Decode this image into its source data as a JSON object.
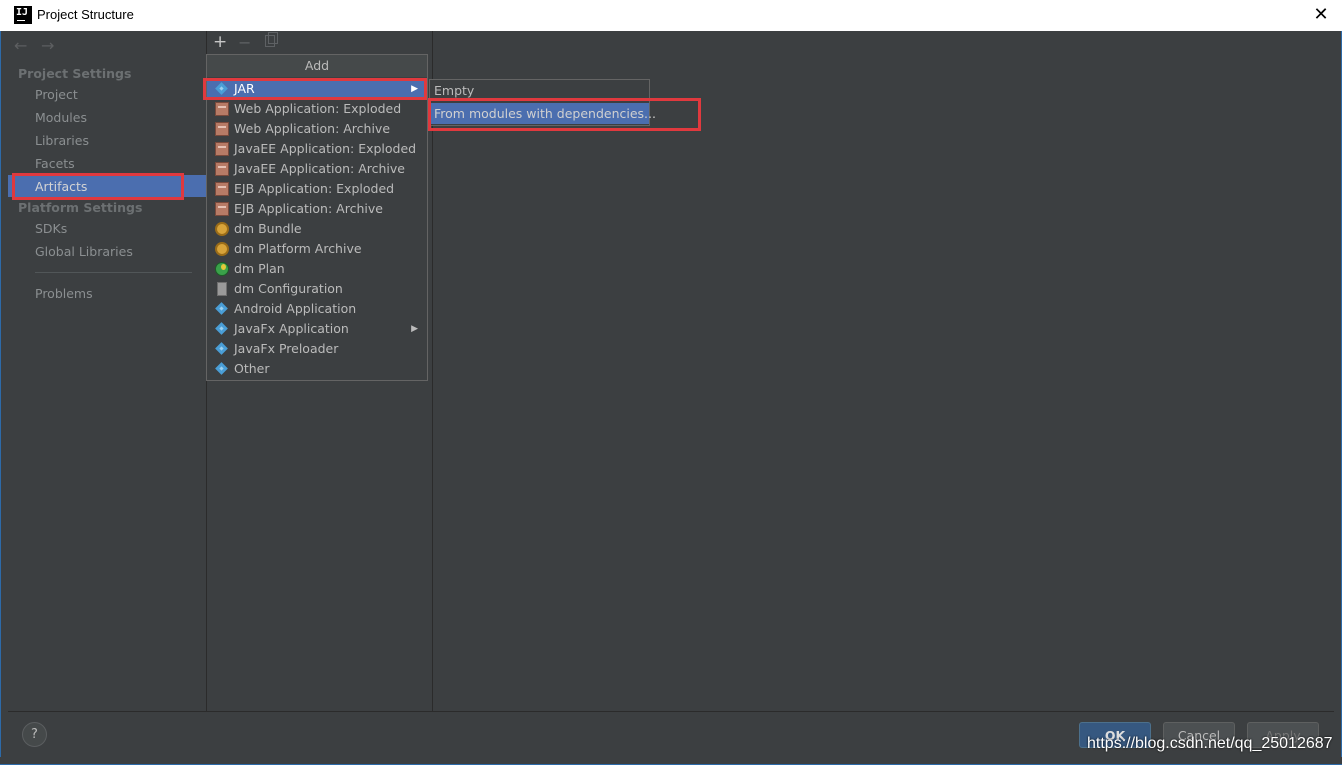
{
  "window": {
    "title": "Project Structure"
  },
  "sidebar": {
    "sections": [
      {
        "label": "Project Settings",
        "items": [
          "Project",
          "Modules",
          "Libraries",
          "Facets",
          "Artifacts"
        ]
      },
      {
        "label": "Platform Settings",
        "items": [
          "SDKs",
          "Global Libraries"
        ]
      }
    ],
    "problems": "Problems",
    "selected": "Artifacts"
  },
  "toolbar": {
    "add_symbol": "+",
    "remove_symbol": "−"
  },
  "popup": {
    "header": "Add",
    "items": [
      {
        "label": "JAR",
        "icon": "diamond-icon",
        "submenu": true,
        "selected": true
      },
      {
        "label": "Web Application: Exploded",
        "icon": "web-app-icon"
      },
      {
        "label": "Web Application: Archive",
        "icon": "web-app-icon"
      },
      {
        "label": "JavaEE Application: Exploded",
        "icon": "javaee-icon"
      },
      {
        "label": "JavaEE Application: Archive",
        "icon": "javaee-icon"
      },
      {
        "label": "EJB Application: Exploded",
        "icon": "ejb-icon"
      },
      {
        "label": "EJB Application: Archive",
        "icon": "ejb-icon"
      },
      {
        "label": "dm Bundle",
        "icon": "bundle-gear-icon"
      },
      {
        "label": "dm Platform Archive",
        "icon": "bundle-gear-icon"
      },
      {
        "label": "dm Plan",
        "icon": "globe-icon"
      },
      {
        "label": "dm Configuration",
        "icon": "file-icon"
      },
      {
        "label": "Android Application",
        "icon": "diamond-icon"
      },
      {
        "label": "JavaFx Application",
        "icon": "diamond-icon",
        "submenu": true
      },
      {
        "label": "JavaFx Preloader",
        "icon": "diamond-icon"
      },
      {
        "label": "Other",
        "icon": "diamond-icon"
      }
    ]
  },
  "submenu": {
    "items": [
      {
        "label": "Empty"
      },
      {
        "label": "From modules with dependencies...",
        "selected": true
      }
    ]
  },
  "footer": {
    "help": "?",
    "ok": "OK",
    "cancel": "Cancel",
    "apply": "Apply"
  },
  "watermark": "https://blog.csdn.net/qq_25012687",
  "colors": {
    "background": "#3c3f41",
    "selection": "#4b6eaf",
    "annotation_red": "#e0393e",
    "ok_button": "#365880"
  }
}
